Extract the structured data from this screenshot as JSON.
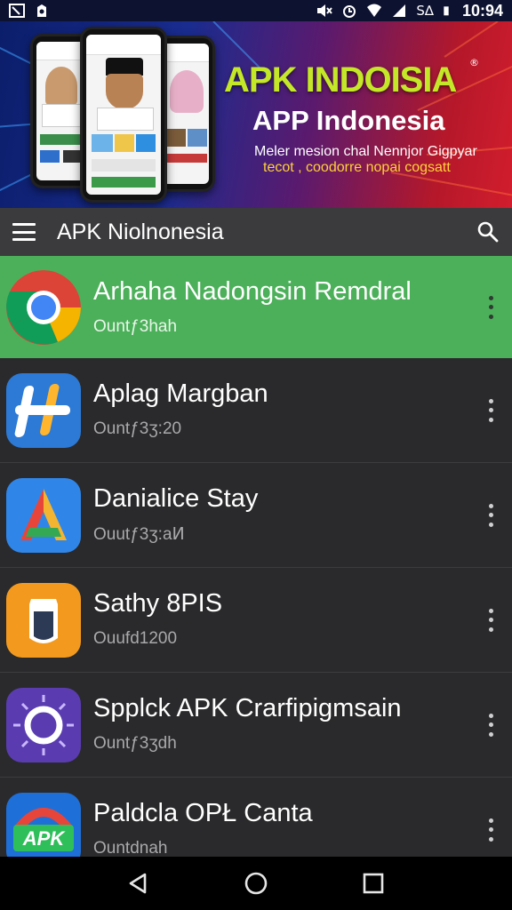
{
  "status_bar": {
    "time": "10:94",
    "extra": "S∆",
    "icons": [
      "screenshot-icon",
      "notification-icon",
      "mute-icon",
      "wifi-icon",
      "signal-icon",
      "battery-icon"
    ]
  },
  "banner": {
    "headline": "APK INDOISIA",
    "registered_mark": "®",
    "subheadline": "APP Indonesia",
    "tagline_1": "Meler mesion chal Nennjor Gigpyar",
    "tagline_2": "tecot , coodorre nopai cogsatt",
    "colors": {
      "headline": "#c4e827",
      "tagline_2": "#ffd13a"
    }
  },
  "app_bar": {
    "title": "APK Niolnonesia",
    "menu_icon": "hamburger-menu-icon",
    "search_icon": "search-icon"
  },
  "apps": [
    {
      "name": "Arhaha Nadongsin Remdral",
      "subtitle": "Ountƒ3hah",
      "icon": "chrome-icon",
      "selected": true
    },
    {
      "name": "Aplag Margban",
      "subtitle": "Ountƒ3ʒ:20",
      "icon": "hash-app-icon",
      "selected": false
    },
    {
      "name": "Danialice Stay",
      "subtitle": "Ouutƒ3ʒ:aͶ",
      "icon": "a-triangle-app-icon",
      "selected": false
    },
    {
      "name": "Sathy 8PIS",
      "subtitle": "Ouufd1200",
      "icon": "shield-app-icon",
      "selected": false
    },
    {
      "name": "Spplck APK Crarfipigmsain",
      "subtitle": "Ountƒ3ʒdh",
      "icon": "sun-app-icon",
      "selected": false
    },
    {
      "name": "Paldcla OPŁ Canta",
      "subtitle": "Ountdnah",
      "icon": "apk-app-icon",
      "selected": false
    }
  ],
  "accent_color": "#4cb05a",
  "nav_bar": {
    "icons": [
      "back-icon",
      "home-icon",
      "recents-icon"
    ]
  }
}
